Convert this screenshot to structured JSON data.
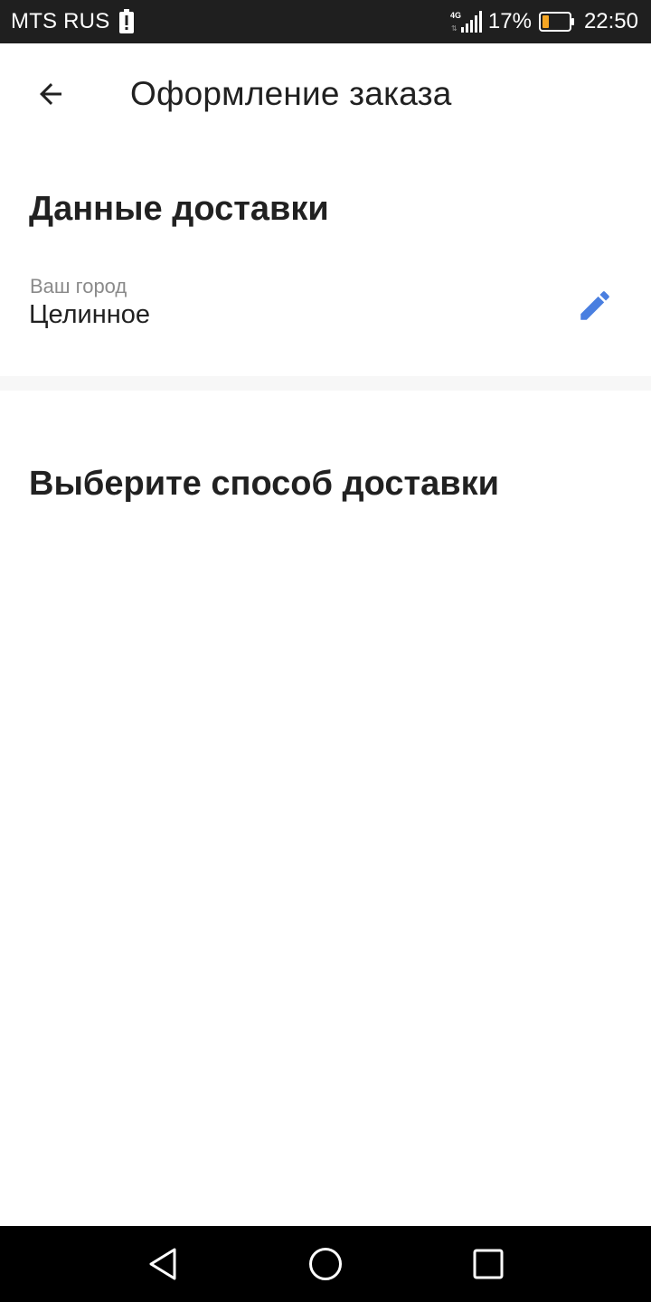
{
  "status_bar": {
    "carrier": "MTS RUS",
    "network": "4G",
    "battery_percent": "17%",
    "time": "22:50",
    "icons": [
      "alert-icon",
      "signal-icon",
      "battery-icon"
    ]
  },
  "app_bar": {
    "title": "Оформление заказа",
    "back_icon": "arrow-left-icon"
  },
  "delivery": {
    "heading": "Данные доставки",
    "city_label": "Ваш город",
    "city_value": "Целинное",
    "edit_icon": "pencil-icon"
  },
  "delivery_method": {
    "heading": "Выберите способ доставки"
  },
  "nav_bar": {
    "icons": [
      "back-triangle-icon",
      "home-circle-icon",
      "recents-square-icon"
    ]
  },
  "colors": {
    "status_bar_bg": "#1f1f1f",
    "accent": "#4a7fe0",
    "battery_level": "#f5a623",
    "text_primary": "#212121",
    "text_secondary": "#8a8a8a",
    "nav_bar_bg": "#000000"
  }
}
